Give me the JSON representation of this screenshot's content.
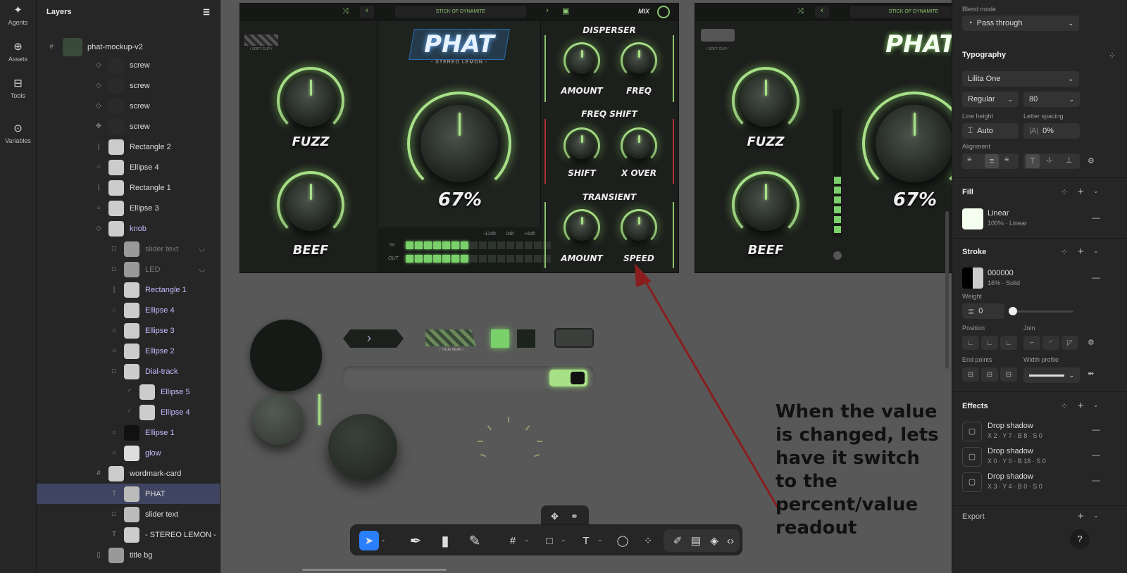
{
  "rail": {
    "items": [
      {
        "label": "Agents",
        "icon": "✦"
      },
      {
        "label": "Assets",
        "icon": "⊕"
      },
      {
        "label": "Tools",
        "icon": "⊟"
      },
      {
        "label": "Variables",
        "icon": "⊙"
      }
    ]
  },
  "layers": {
    "title": "Layers",
    "root": "phat-mockup-v2",
    "rows": [
      {
        "label": "screw",
        "icon": "◇"
      },
      {
        "label": "screw",
        "icon": "◇"
      },
      {
        "label": "screw",
        "icon": "◇"
      },
      {
        "label": "screw",
        "icon": "✥"
      },
      {
        "label": "Rectangle 2",
        "icon": "|"
      },
      {
        "label": "Ellipse 4",
        "icon": "○"
      },
      {
        "label": "Rectangle 1",
        "icon": "|"
      },
      {
        "label": "Ellipse 3",
        "icon": "○"
      },
      {
        "label": "knob",
        "icon": "◇"
      },
      {
        "label": "slider text",
        "icon": "□"
      },
      {
        "label": "LED",
        "icon": "□"
      },
      {
        "label": "Rectangle 1",
        "icon": "|"
      },
      {
        "label": "Ellipse 4",
        "icon": "◌"
      },
      {
        "label": "Ellipse 3",
        "icon": "○"
      },
      {
        "label": "Ellipse 2",
        "icon": "○"
      },
      {
        "label": "Dial-track",
        "icon": "□"
      },
      {
        "label": "Ellipse 5",
        "icon": "◜"
      },
      {
        "label": "Ellipse 4",
        "icon": "◜"
      },
      {
        "label": "Ellipse 1",
        "icon": "○"
      },
      {
        "label": "glow",
        "icon": "○"
      },
      {
        "label": "wordmark-card",
        "icon": "#"
      },
      {
        "label": "PHAT",
        "icon": "T"
      },
      {
        "label": "slider text",
        "icon": "□"
      },
      {
        "label": "- STEREO LEMON -",
        "icon": "T"
      },
      {
        "label": "title bg",
        "icon": "▯"
      }
    ]
  },
  "plugin": {
    "preset": "STICK OF DYNAMITE",
    "mix": "MIX",
    "clip": "/ SOFT CLIP /",
    "logo": "PHAT",
    "subtitle": "- STEREO LEMON -",
    "fuzz": "FUZZ",
    "beef": "BEEF",
    "percent": "67%",
    "disperser": "DISPERSER",
    "amount": "AMOUNT",
    "freq": "FREQ",
    "freq_shift": "FREQ SHIFT",
    "shift": "SHIFT",
    "xover": "X OVER",
    "transient": "TRANSIENT",
    "speed": "SPEED",
    "meter_in": "IN",
    "meter_out": "OUT",
    "db_ticks": [
      "-12db",
      "0db",
      "+6db"
    ],
    "in_level": 0.45,
    "out_level": 0.45,
    "true_peak": "/ TRUE PEAK /"
  },
  "annotation": "When the value is changed, lets have it switch to the percent/value readout",
  "panel": {
    "blend_label": "Blend mode",
    "blend": "Pass through",
    "typography": "Typography",
    "font": "Lilita One",
    "weight": "Regular",
    "size": "80",
    "line_height_label": "Line height",
    "line_height": "Auto",
    "letter_spacing_label": "Letter spacing",
    "letter_spacing": "0%",
    "alignment": "Alignment",
    "fill": "Fill",
    "fill_type": "Linear",
    "fill_sub": "100% · Linear",
    "stroke": "Stroke",
    "stroke_hex": "000000",
    "stroke_sub": "16% · Solid",
    "weight_label": "Weight",
    "weight_val": "0",
    "position": "Position",
    "join": "Join",
    "end_points": "End points",
    "width_profile": "Width profile",
    "effects": "Effects",
    "effects_list": [
      {
        "name": "Drop shadow",
        "detail": "X 2 · Y 7 · B 8 · S 0"
      },
      {
        "name": "Drop shadow",
        "detail": "X 0 · Y 0 · B 18 · S 0"
      },
      {
        "name": "Drop shadow",
        "detail": "X 3 · Y 4 · B 0 · S 0"
      }
    ],
    "export": "Export",
    "help": "?"
  }
}
